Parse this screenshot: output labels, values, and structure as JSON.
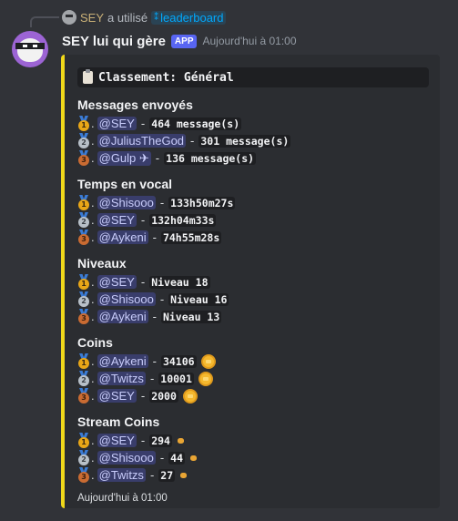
{
  "reply": {
    "name": "SEY",
    "action": "a utilisé",
    "command": "leaderboard",
    "command_icon": "slash-command-icon"
  },
  "message": {
    "username": "SEY lui qui gère",
    "tag": "APP",
    "timestamp": "Aujourd'hui à 01:00"
  },
  "embed": {
    "accent_color": "#f0d81a",
    "title": "Classement: Général",
    "title_icon": "clipboard-icon",
    "footer": "Aujourd'hui à 01:00",
    "sections": [
      {
        "title": "Messages envoyés",
        "rows": [
          {
            "rank": "1",
            "medal": "gold",
            "user": "@SEY",
            "value": "464 message(s)"
          },
          {
            "rank": "2",
            "medal": "silver",
            "user": "@JuliusTheGod",
            "value": "301 message(s)"
          },
          {
            "rank": "3",
            "medal": "bronze",
            "user": "@Gulp ✈",
            "value": "136 message(s)"
          }
        ]
      },
      {
        "title": "Temps en vocal",
        "rows": [
          {
            "rank": "1",
            "medal": "gold",
            "user": "@Shisooo",
            "value": "133h50m27s"
          },
          {
            "rank": "2",
            "medal": "silver",
            "user": "@SEY",
            "value": "132h04m33s"
          },
          {
            "rank": "3",
            "medal": "bronze",
            "user": "@Aykeni",
            "value": "74h55m28s"
          }
        ]
      },
      {
        "title": "Niveaux",
        "rows": [
          {
            "rank": "1",
            "medal": "gold",
            "user": "@SEY",
            "value": "Niveau 18"
          },
          {
            "rank": "2",
            "medal": "silver",
            "user": "@Shisooo",
            "value": "Niveau 16"
          },
          {
            "rank": "3",
            "medal": "bronze",
            "user": "@Aykeni",
            "value": "Niveau 13"
          }
        ]
      },
      {
        "title": "Coins",
        "rows": [
          {
            "rank": "1",
            "medal": "gold",
            "user": "@Aykeni",
            "value": "34106"
          },
          {
            "rank": "2",
            "medal": "silver",
            "user": "@Twitzs",
            "value": "10001"
          },
          {
            "rank": "3",
            "medal": "bronze",
            "user": "@SEY",
            "value": "2000"
          }
        ]
      },
      {
        "title": "Stream Coins",
        "rows": [
          {
            "rank": "1",
            "medal": "gold",
            "user": "@SEY",
            "value": "294"
          },
          {
            "rank": "2",
            "medal": "silver",
            "user": "@Shisooo",
            "value": "44"
          },
          {
            "rank": "3",
            "medal": "bronze",
            "user": "@Twitzs",
            "value": "27"
          }
        ]
      }
    ]
  }
}
